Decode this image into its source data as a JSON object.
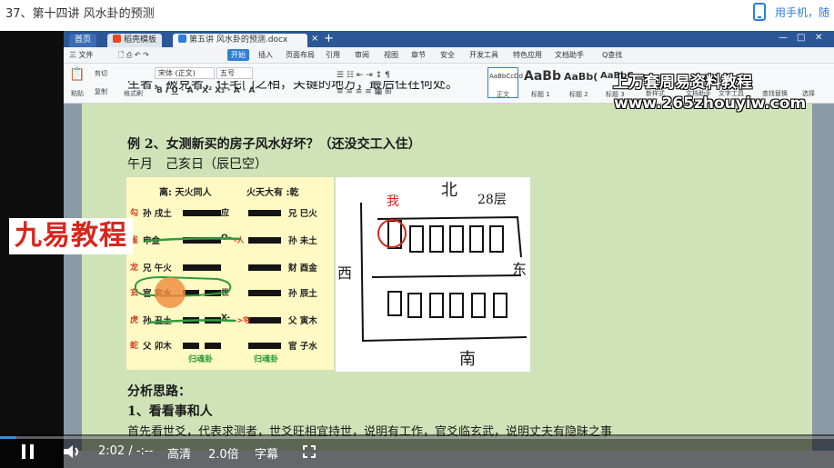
{
  "page": {
    "title": "37、第十四讲 风水卦的预测",
    "phone_link": "用手机，随"
  },
  "wps": {
    "tabs": [
      "首页",
      "稻壳模板",
      "第五讲 风水卦的预测.docx"
    ],
    "menu": [
      "三 文件",
      "开始",
      "插入",
      "页面布局",
      "引用",
      "审阅",
      "视图",
      "章节",
      "安全",
      "开发工具",
      "特色应用",
      "文档助手",
      "Q查找"
    ],
    "ribbon": {
      "paste": "粘贴",
      "cut": "剪切",
      "copy": "复制",
      "format_painter": "格式刷",
      "font": "宋体 (正文)",
      "size": "五号",
      "styles": [
        {
          "sample": "AaBbCcDd",
          "name": "正文"
        },
        {
          "sample": "AaBb",
          "name": "标题 1"
        },
        {
          "sample": "AaBb(",
          "name": "标题 2"
        },
        {
          "sample": "AaBbC",
          "name": "标题 3"
        }
      ],
      "new_style": "新样式",
      "doc_assistant": "文档助手",
      "text_tools": "文字工具",
      "find_replace": "查找替换",
      "select": "选择"
    }
  },
  "watermark": {
    "line1": "上万套周易资料教程",
    "line2": "www.265zhouyiw.com"
  },
  "logo": "九易教程",
  "document": {
    "example_title": "例 2、女测新买的房子风水好坏？（还没交工入住）",
    "date_line": "午月　己亥日（辰巳空）",
    "analysis_heading": "分析思路：",
    "point1": "1、看看事和人",
    "cut_top": "生者，被克者，住宅门之相，关键的地方，最后住在何处。",
    "cut_bottom": "首先看世爻，代表求测者，世爻旺相宜持世，说明有工作，官爻临玄武，说明丈夫有隐昧之事"
  },
  "hexagram": {
    "left_header": "离: 天火同人",
    "right_header": "火天大有 :乾",
    "rows": [
      {
        "spirit": "勾",
        "left": "孙 戌土",
        "mark": "应",
        "change_note": "",
        "right": "兄 巳火"
      },
      {
        "spirit": "雀",
        "left": "申金",
        "mark": "O-",
        "change_note": "-人",
        "right": "孙 未土"
      },
      {
        "spirit": "龙",
        "left": "兄 午火",
        "mark": "",
        "change_note": "",
        "right": "财 酉金"
      },
      {
        "spirit": "玄",
        "left": "官 亥水",
        "mark": "世",
        "change_note": "",
        "right": "孙 辰土"
      },
      {
        "spirit": "虎",
        "left": "孙 丑土",
        "mark": "X-",
        "change_note": "->宅",
        "right": "父 寅木"
      },
      {
        "spirit": "蛇",
        "left": "父 卯木",
        "mark": "",
        "change_note": "",
        "right": "官 子水"
      }
    ],
    "left_footer": "归魂卦",
    "right_footer": "归魂卦"
  },
  "sketch": {
    "north": "北",
    "floor": "28层",
    "west": "西",
    "east": "东",
    "south": "南",
    "marker": "我"
  },
  "player": {
    "time": "2:02 / -:--",
    "quality": "高清",
    "speed": "2.0倍",
    "subtitle": "字幕",
    "progress": 0.02,
    "accent": "#2f8fe8"
  }
}
